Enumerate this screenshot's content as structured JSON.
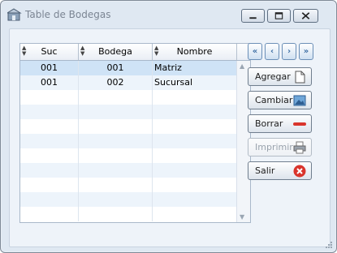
{
  "window": {
    "title": "Table de Bodegas"
  },
  "grid": {
    "columns": [
      "Suc",
      "Bodega",
      "Nombre"
    ],
    "rows": [
      {
        "suc": "001",
        "bodega": "001",
        "nombre": "Matriz",
        "selected": true
      },
      {
        "suc": "001",
        "bodega": "002",
        "nombre": "Sucursal",
        "selected": false
      }
    ]
  },
  "nav": {
    "first": "«",
    "prev": "‹",
    "next": "›",
    "last": "»"
  },
  "buttons": {
    "agregar": "Agregar",
    "cambiar": "Cambiar",
    "borrar": "Borrar",
    "imprimir": "Imprimir",
    "salir": "Salir"
  },
  "colors": {
    "accent": "#3d6fa5",
    "selected_row": "#cfe3f6",
    "danger": "#d9342b"
  }
}
